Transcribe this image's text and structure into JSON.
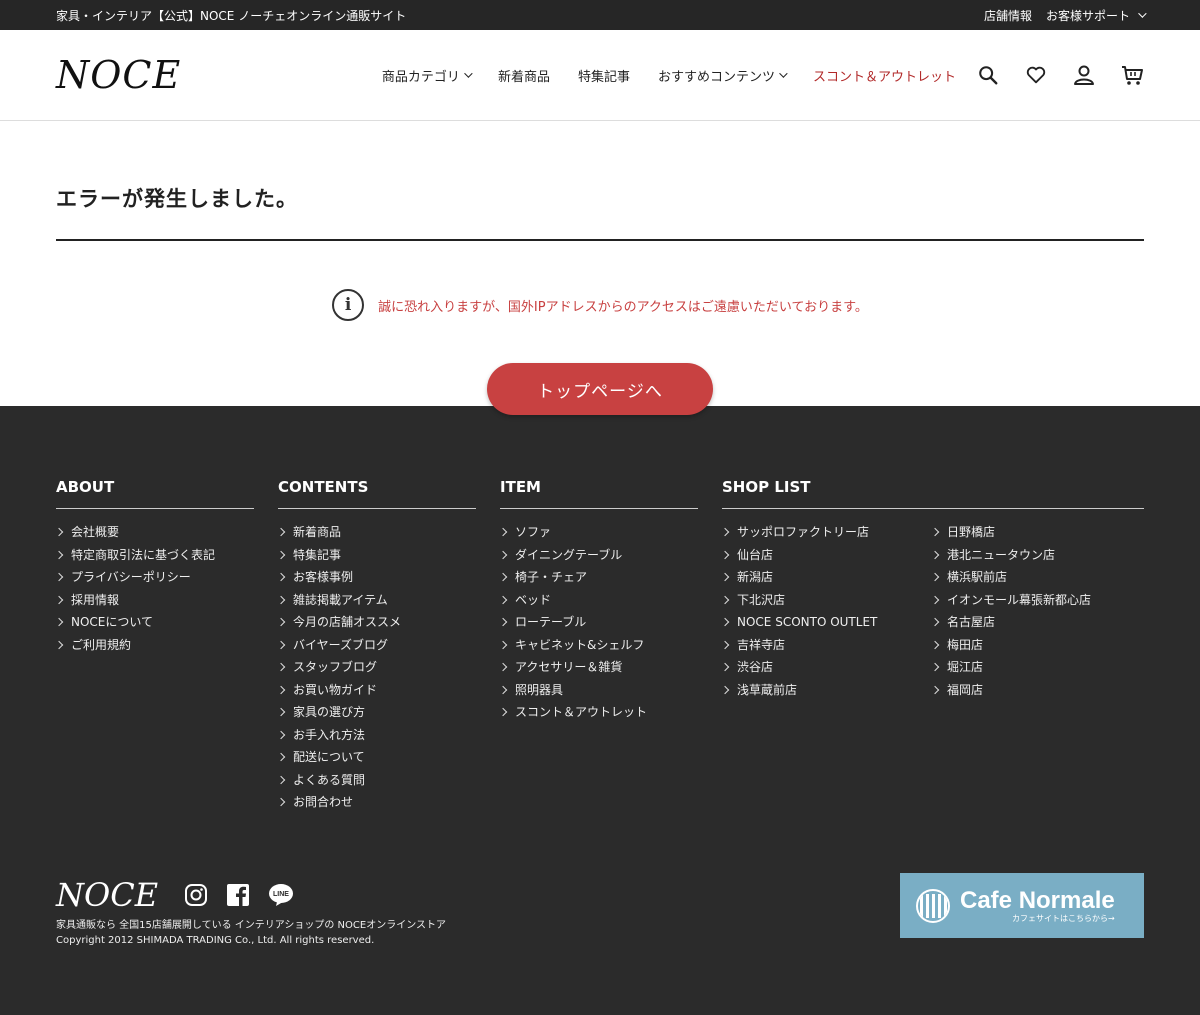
{
  "topbar": {
    "site_title": "家具・インテリア【公式】NOCE ノーチェオンライン通販サイト",
    "links": [
      "店舗情報",
      "お客様サポート"
    ]
  },
  "header": {
    "logo": "NOCE",
    "nav": [
      "商品カテゴリ",
      "新着商品",
      "特集記事",
      "おすすめコンテンツ",
      "スコント＆アウトレット"
    ],
    "icons": [
      "search-icon",
      "heart-icon",
      "user-icon",
      "cart-icon"
    ],
    "accent_color": "#b22a2a"
  },
  "main": {
    "title": "エラーが発生しました。",
    "message": "誠に恐れ入りますが、国外IPアドレスからのアクセスはご遠慮いただいております。",
    "button_label": "トップページへ",
    "button_color": "#c84141"
  },
  "footer": {
    "about": {
      "heading": "ABOUT",
      "items": [
        "会社概要",
        "特定商取引法に基づく表記",
        "プライバシーポリシー",
        "採用情報",
        "NOCEについて",
        "ご利用規約"
      ]
    },
    "contents": {
      "heading": "CONTENTS",
      "items": [
        "新着商品",
        "特集記事",
        "お客様事例",
        "雑誌掲載アイテム",
        "今月の店舗オススメ",
        "バイヤーズブログ",
        "スタッフブログ",
        "お買い物ガイド",
        "家具の選び方",
        "お手入れ方法",
        "配送について",
        "よくある質問",
        "お問合わせ"
      ]
    },
    "item": {
      "heading": "ITEM",
      "items": [
        "ソファ",
        "ダイニングテーブル",
        "椅子・チェア",
        "ベッド",
        "ローテーブル",
        "キャビネット&シェルフ",
        "アクセサリー＆雑貨",
        "照明器具",
        "スコント＆アウトレット"
      ]
    },
    "shop": {
      "heading": "SHOP LIST",
      "col1": [
        "サッポロファクトリー店",
        "仙台店",
        "新潟店",
        "下北沢店",
        "NOCE SCONTO OUTLET",
        "吉祥寺店",
        "渋谷店",
        "浅草蔵前店"
      ],
      "col2": [
        "日野橋店",
        "港北ニュータウン店",
        "横浜駅前店",
        "イオンモール幕張新都心店",
        "名古屋店",
        "梅田店",
        "堀江店",
        "福岡店"
      ]
    },
    "logo": "NOCE",
    "sns": [
      "instagram-icon",
      "facebook-icon",
      "line-icon"
    ],
    "line_label": "LINE",
    "description": "家具通販なら 全国15店舗展開している インテリアショップの NOCEオンラインストア",
    "copyright": "Copyright 2012 SHIMADA TRADING Co., Ltd. All rights reserved.",
    "cafe": {
      "name": "Cafe Normale",
      "sub": "カフェサイトはこちらから→"
    }
  }
}
